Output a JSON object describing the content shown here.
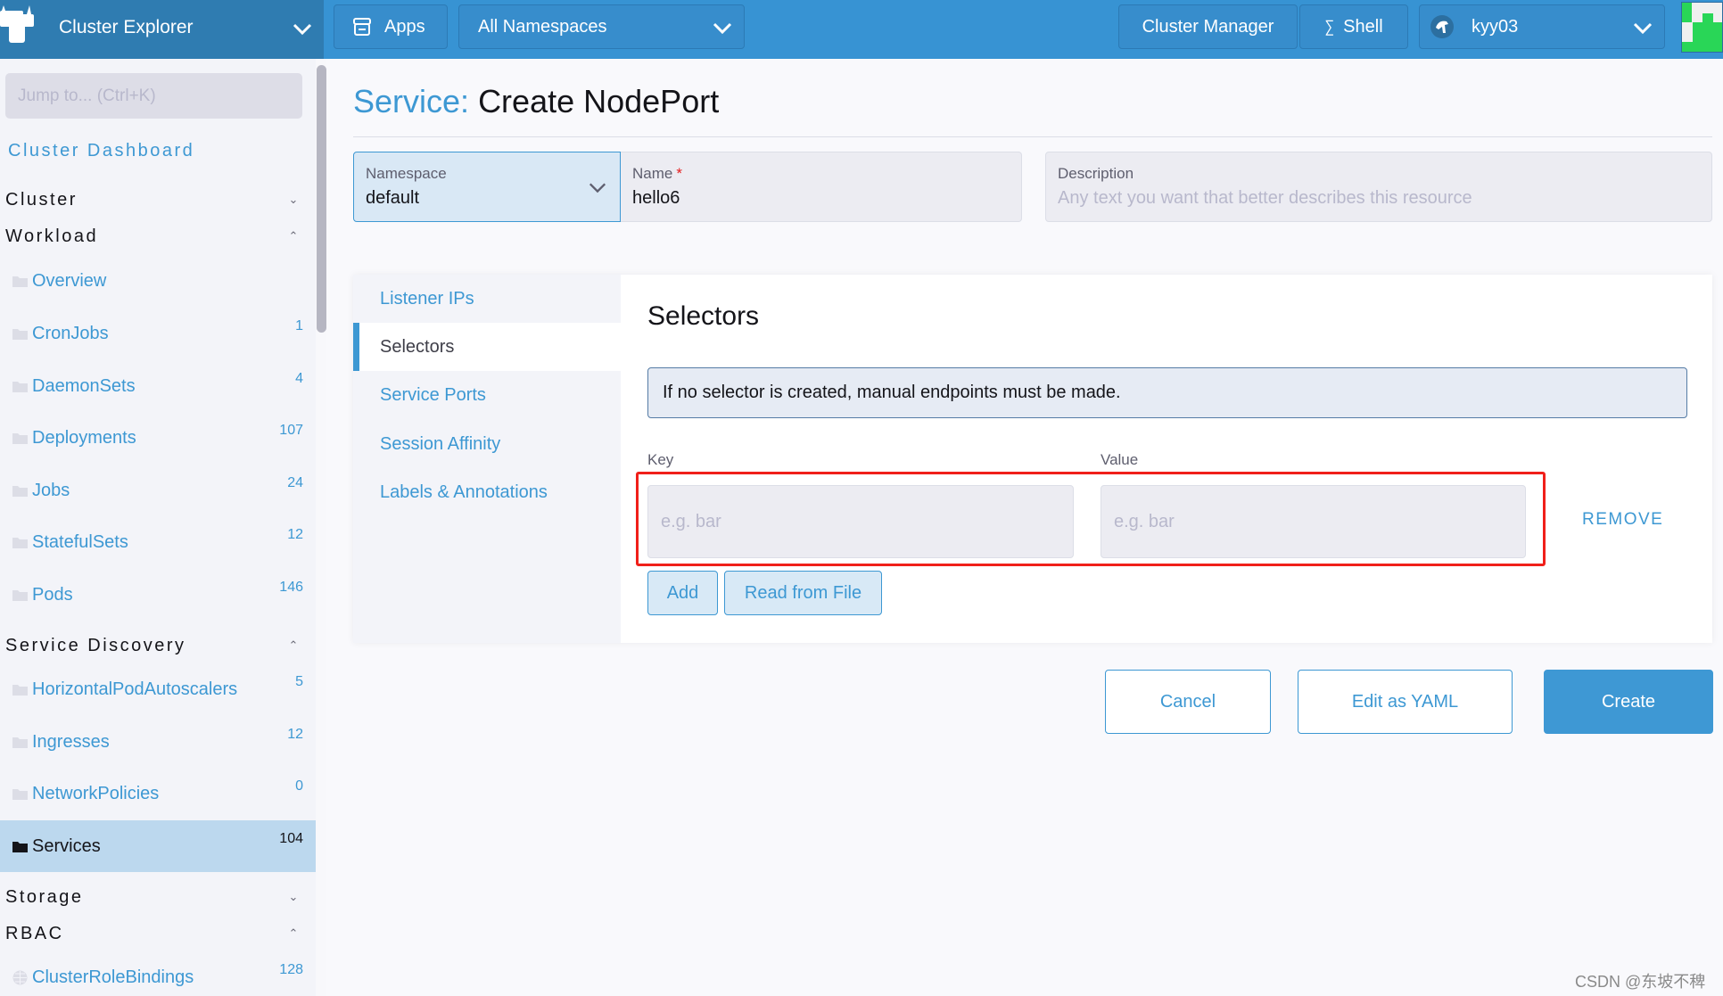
{
  "header": {
    "brand_title": "Cluster Explorer",
    "apps_label": "Apps",
    "namespace_selector": "All Namespaces",
    "cluster_manager_label": "Cluster Manager",
    "shell_label": "Shell",
    "user_label": "kyy03"
  },
  "sidebar": {
    "jump_placeholder": "Jump to... (Ctrl+K)",
    "dashboard_link": "Cluster Dashboard",
    "groups": {
      "cluster": {
        "label": "Cluster",
        "expanded": false
      },
      "workload": {
        "label": "Workload",
        "expanded": true,
        "items": [
          {
            "label": "Overview",
            "count": ""
          },
          {
            "label": "CronJobs",
            "count": "1"
          },
          {
            "label": "DaemonSets",
            "count": "4"
          },
          {
            "label": "Deployments",
            "count": "107"
          },
          {
            "label": "Jobs",
            "count": "24"
          },
          {
            "label": "StatefulSets",
            "count": "12"
          },
          {
            "label": "Pods",
            "count": "146"
          }
        ]
      },
      "service_discovery": {
        "label": "Service Discovery",
        "expanded": true,
        "items": [
          {
            "label": "HorizontalPodAutoscalers",
            "count": "5"
          },
          {
            "label": "Ingresses",
            "count": "12"
          },
          {
            "label": "NetworkPolicies",
            "count": "0"
          },
          {
            "label": "Services",
            "count": "104",
            "active": true
          }
        ]
      },
      "storage": {
        "label": "Storage",
        "expanded": false
      },
      "rbac": {
        "label": "RBAC",
        "expanded": true,
        "items": [
          {
            "label": "ClusterRoleBindings",
            "count": "128"
          }
        ]
      }
    }
  },
  "page": {
    "title_prefix": "Service:",
    "title": "Create NodePort",
    "namespace": {
      "label": "Namespace",
      "value": "default"
    },
    "name": {
      "label": "Name",
      "required_mark": "*",
      "value": "hello6"
    },
    "description": {
      "label": "Description",
      "placeholder": "Any text you want that better describes this resource",
      "value": ""
    }
  },
  "tabs": [
    {
      "label": "Listener IPs",
      "active": false
    },
    {
      "label": "Selectors",
      "active": true
    },
    {
      "label": "Service Ports",
      "active": false
    },
    {
      "label": "Session Affinity",
      "active": false
    },
    {
      "label": "Labels & Annotations",
      "active": false
    }
  ],
  "selectors": {
    "title": "Selectors",
    "banner": "If no selector is created, manual endpoints must be made.",
    "key_label": "Key",
    "value_label": "Value",
    "rows": [
      {
        "key": "",
        "key_placeholder": "e.g. bar",
        "value": "",
        "value_placeholder": "e.g. bar",
        "remove_label": "REMOVE"
      }
    ],
    "add_label": "Add",
    "read_from_file_label": "Read from File"
  },
  "footer": {
    "cancel_label": "Cancel",
    "edit_yaml_label": "Edit as YAML",
    "create_label": "Create"
  },
  "watermark": "CSDN @东坡不稗",
  "colors": {
    "brand_bar": "#2f7cb1",
    "top_bar": "#3793d3",
    "accent": "#3d98d3",
    "active_nav": "#bcd8ee",
    "highlight_box": "#f0201a",
    "avatar_green": "#29d657"
  }
}
